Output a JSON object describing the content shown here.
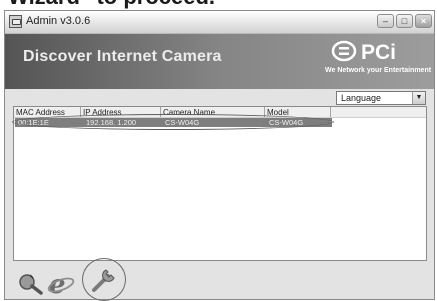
{
  "caption": "Wizard\" to proceed.",
  "window": {
    "title": "Admin v3.0.6",
    "controls": {
      "minimize": "–",
      "maximize": "□",
      "close": "×"
    }
  },
  "header": {
    "title": "Discover Internet Camera",
    "logo_text": "PCi",
    "tagline": "We Network your Entertainment"
  },
  "language": {
    "selected": "Language"
  },
  "list": {
    "columns": [
      "MAC Address",
      "IP Address",
      "Camera Name",
      "Model"
    ],
    "rows": [
      {
        "mac": "00:1E:1E",
        "ip": "192.168. 1.200",
        "name": "CS-W04G",
        "model": "CS-W04G"
      }
    ]
  },
  "toolbar_icons": [
    "search-icon",
    "internet-explorer-icon",
    "wizard-tool-icon"
  ],
  "colors": {
    "header_gradient_start": "#545454",
    "header_gradient_end": "#9d9d9d",
    "selected_row": "#7e7e7e"
  }
}
